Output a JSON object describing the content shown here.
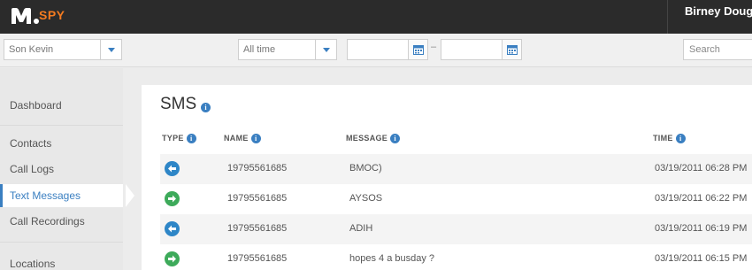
{
  "topbar": {
    "logo_text": "SPY",
    "user_name": "Birney Dougl",
    "brand_color": "#f47b20"
  },
  "filters": {
    "device_select": "Son Kevin",
    "period_select": "All time",
    "date_separator": "–",
    "search_placeholder": "Search",
    "calendar_icon": "calendar-icon"
  },
  "sidebar": {
    "items": [
      {
        "label": "Dashboard"
      },
      {
        "label": "Contacts"
      },
      {
        "label": "Call Logs"
      },
      {
        "label": "Text Messages",
        "active": true
      },
      {
        "label": "Call Recordings"
      },
      {
        "label": "Locations"
      }
    ]
  },
  "main": {
    "title": "SMS",
    "columns": [
      "TYPE",
      "NAME",
      "MESSAGE",
      "TIME"
    ],
    "rows": [
      {
        "type": "incoming",
        "name": "19795561685",
        "message": "BMOC)",
        "time": "03/19/2011 06:28 PM"
      },
      {
        "type": "outgoing",
        "name": "19795561685",
        "message": "AYSOS",
        "time": "03/19/2011 06:22 PM"
      },
      {
        "type": "incoming",
        "name": "19795561685",
        "message": "ADIH",
        "time": "03/19/2011 06:19 PM"
      },
      {
        "type": "outgoing",
        "name": "19795561685",
        "message": "hopes 4 a busday ?",
        "time": "03/19/2011 06:15 PM"
      }
    ]
  },
  "colors": {
    "accent": "#3a7fc1",
    "incoming": "#2e86c7",
    "outgoing": "#3daa5a"
  }
}
